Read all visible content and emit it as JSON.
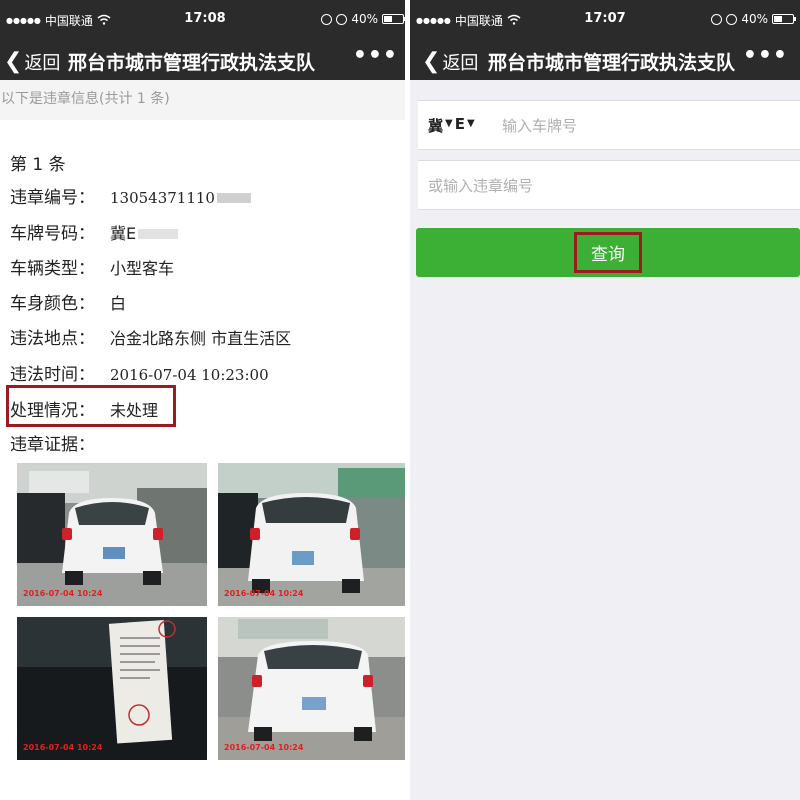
{
  "left": {
    "status": {
      "carrier": "中国联通",
      "time": "17:08",
      "battery": "40%",
      "battery_level": 0.4
    },
    "nav": {
      "back": "返回",
      "title": "邢台市城市管理行政执法支队",
      "more": "•••"
    },
    "info_note": "以下是违章信息(共计 1 条)",
    "record": {
      "index": "第 1 条",
      "fields": [
        {
          "label": "违章编号：",
          "value": "13054371110"
        },
        {
          "label": "车牌号码：",
          "value": "冀E"
        },
        {
          "label": "车辆类型：",
          "value": "小型客车"
        },
        {
          "label": "车身颜色：",
          "value": "白"
        },
        {
          "label": "违法地点：",
          "value": "冶金北路东侧 市直生活区"
        },
        {
          "label": "违法时间：",
          "value": "2016-07-04 10:23:00"
        },
        {
          "label": "处理情况：",
          "value": "未处理"
        },
        {
          "label": "违章证据：",
          "value": ""
        }
      ],
      "photos": [
        {
          "stamp": "2016-07-04 10:24"
        },
        {
          "stamp": "2016-07-04 10:24"
        },
        {
          "stamp": "2016-07-04 10:24"
        },
        {
          "stamp": "2016-07-04 10:24"
        }
      ]
    }
  },
  "right": {
    "status": {
      "carrier": "中国联通",
      "time": "17:07",
      "battery": "40%",
      "battery_level": 0.4
    },
    "nav": {
      "back": "返回",
      "title": "邢台市城市管理行政执法支队",
      "more": "•••"
    },
    "form": {
      "province": "冀",
      "letter": "E",
      "plate_placeholder": "输入车牌号",
      "code_placeholder": "或输入违章编号",
      "query_label": "查询"
    }
  },
  "colors": {
    "bar": "#2b2b2b",
    "accent_green": "#3cb034",
    "highlight_red": "#9b1c1f",
    "stamp_red": "#e02020"
  }
}
